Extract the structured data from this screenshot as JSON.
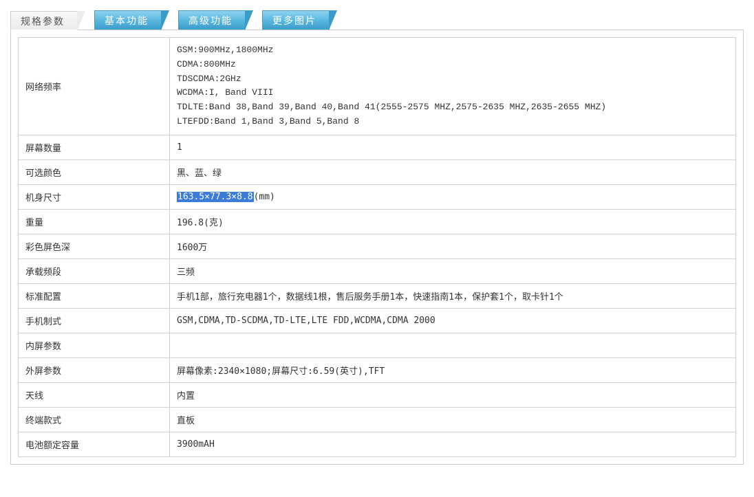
{
  "tabs": {
    "spec": "规格参数",
    "basic": "基本功能",
    "advanced": "高级功能",
    "more_images": "更多图片"
  },
  "rows": {
    "network_freq": {
      "label": "网络频率",
      "lines": [
        "GSM:900MHz,1800MHz",
        "CDMA:800MHz",
        "TDSCDMA:2GHz",
        "WCDMA:I, Band VIII",
        "TDLTE:Band 38,Band 39,Band 40,Band 41(2555-2575 MHZ,2575-2635 MHZ,2635-2655 MHZ)",
        "LTEFDD:Band 1,Band 3,Band 5,Band 8"
      ]
    },
    "screen_count": {
      "label": "屏幕数量",
      "value": "1"
    },
    "colors": {
      "label": "可选颜色",
      "value": "黑、蓝、绿"
    },
    "body_size": {
      "label": "机身尺寸",
      "highlight": "163.5×77.3×8.8",
      "suffix": "(mm)"
    },
    "weight": {
      "label": "重量",
      "value": "196.8(克)"
    },
    "color_depth": {
      "label": "彩色屏色深",
      "value": "1600万"
    },
    "carrier_band": {
      "label": "承载频段",
      "value": "三频"
    },
    "standard_config": {
      "label": "标准配置",
      "value": "手机1部，旅行充电器1个，数据线1根，售后服务手册1本，快速指南1本，保护套1个，取卡针1个"
    },
    "phone_standard": {
      "label": "手机制式",
      "value": "GSM,CDMA,TD-SCDMA,TD-LTE,LTE FDD,WCDMA,CDMA 2000"
    },
    "inner_screen": {
      "label": "内屏参数",
      "value": ""
    },
    "outer_screen": {
      "label": "外屏参数",
      "value": "屏幕像素:2340×1080;屏幕尺寸:6.59(英寸),TFT"
    },
    "antenna": {
      "label": "天线",
      "value": "内置"
    },
    "terminal_style": {
      "label": "终端款式",
      "value": "直板"
    },
    "battery": {
      "label": "电池额定容量",
      "value": "3900mAH"
    }
  }
}
